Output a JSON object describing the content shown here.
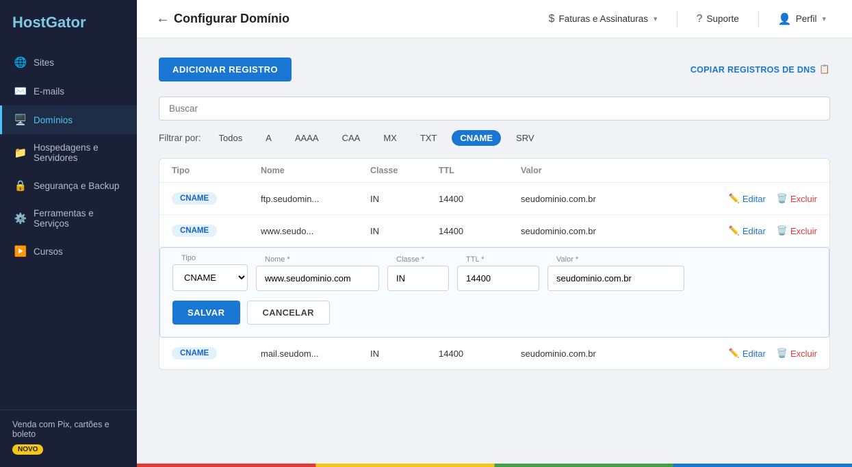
{
  "brand": {
    "name": "HostGator"
  },
  "sidebar": {
    "items": [
      {
        "id": "sites",
        "label": "Sites",
        "icon": "🌐"
      },
      {
        "id": "emails",
        "label": "E-mails",
        "icon": "✉️"
      },
      {
        "id": "dominios",
        "label": "Domínios",
        "icon": "🖥️",
        "active": true
      },
      {
        "id": "hospedagens",
        "label": "Hospedagens e Servidores",
        "icon": "📁"
      },
      {
        "id": "seguranca",
        "label": "Segurança e Backup",
        "icon": "🔒"
      },
      {
        "id": "ferramentas",
        "label": "Ferramentas e Serviços",
        "icon": "⚙️"
      },
      {
        "id": "cursos",
        "label": "Cursos",
        "icon": "▶️"
      }
    ],
    "bottom": {
      "label": "Venda com Pix, cartões e boleto",
      "badge": "NOVO"
    }
  },
  "topbar": {
    "back_label": "Configurar Domínio",
    "actions": [
      {
        "id": "faturas",
        "label": "Faturas e Assinaturas",
        "icon": "$"
      },
      {
        "id": "suporte",
        "label": "Suporte",
        "icon": "?"
      },
      {
        "id": "perfil",
        "label": "Perfil",
        "icon": "👤"
      }
    ]
  },
  "toolbar": {
    "add_button": "ADICIONAR REGISTRO",
    "copy_link": "COPIAR REGISTROS DE DNS"
  },
  "search": {
    "placeholder": "Buscar"
  },
  "filter": {
    "label": "Filtrar por:",
    "options": [
      "Todos",
      "A",
      "AAAA",
      "CAA",
      "MX",
      "TXT",
      "CNAME",
      "SRV"
    ],
    "active": "CNAME"
  },
  "table": {
    "headers": [
      "Tipo",
      "Nome",
      "Classe",
      "TTL",
      "Valor",
      ""
    ],
    "rows": [
      {
        "id": "row1",
        "type": "CNAME",
        "name": "ftp.seudomin...",
        "class": "IN",
        "ttl": "14400",
        "value": "seudominio.com.br",
        "edit_label": "Editar",
        "delete_label": "Excluir"
      },
      {
        "id": "row2",
        "type": "CNAME",
        "name": "www.seudo...",
        "class": "IN",
        "ttl": "14400",
        "value": "seudominio.com.br",
        "edit_label": "Editar",
        "delete_label": "Excluir",
        "is_editing": true
      },
      {
        "id": "row3",
        "type": "CNAME",
        "name": "mail.seudom...",
        "class": "IN",
        "ttl": "14400",
        "value": "seudominio.com.br",
        "edit_label": "Editar",
        "delete_label": "Excluir"
      }
    ]
  },
  "edit_form": {
    "tipo_label": "Tipo",
    "tipo_value": "CNAME",
    "nome_label": "Nome *",
    "nome_value": "www.seudominio.com",
    "classe_label": "Classe *",
    "classe_value": "IN",
    "ttl_label": "TTL *",
    "ttl_value": "14400",
    "valor_label": "Valor *",
    "valor_value": "seudominio.com.br",
    "save_label": "SALVAR",
    "cancel_label": "CANCELAR"
  }
}
